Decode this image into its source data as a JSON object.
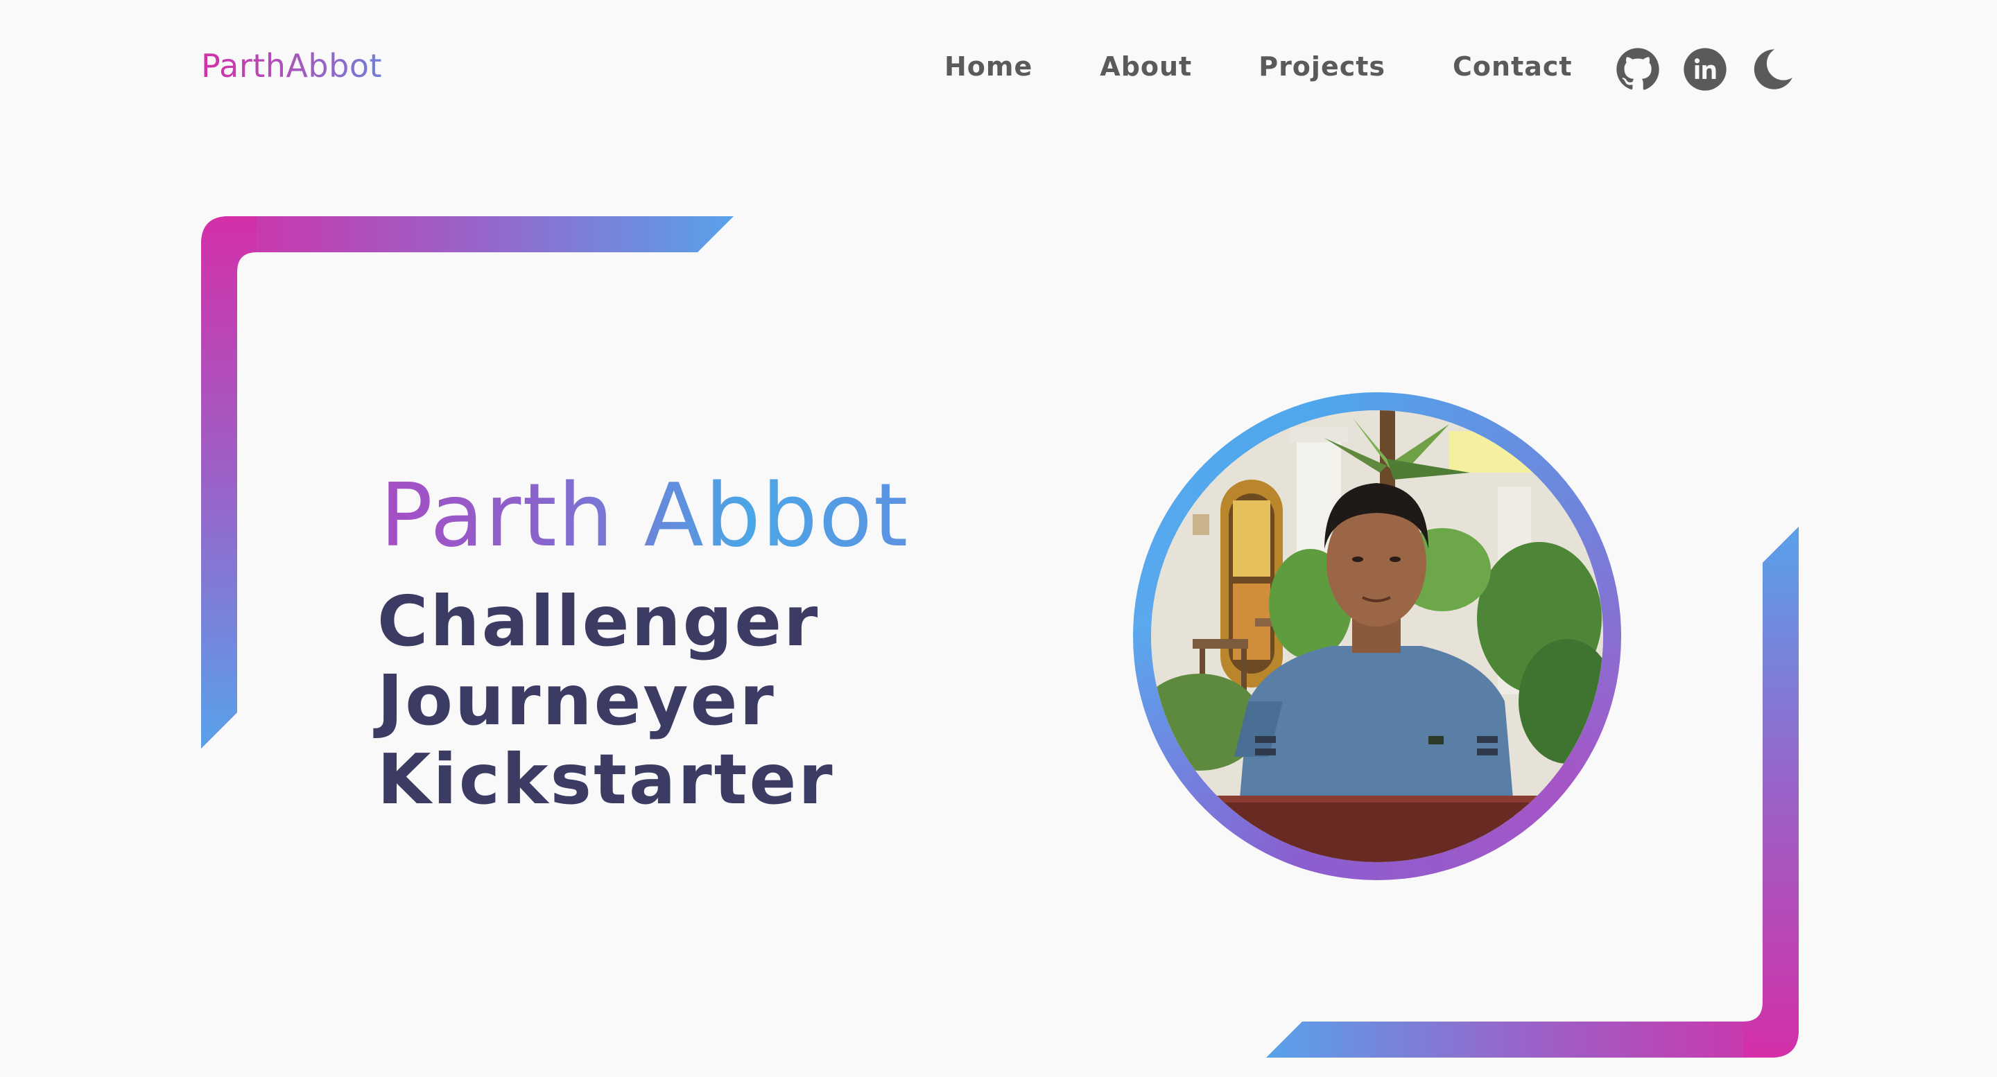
{
  "logo": {
    "text": "ParthAbbot"
  },
  "nav": {
    "items": [
      {
        "label": "Home"
      },
      {
        "label": "About"
      },
      {
        "label": "Projects"
      },
      {
        "label": "Contact"
      }
    ],
    "icons": [
      "github-icon",
      "linkedin-icon",
      "moon-icon"
    ]
  },
  "hero": {
    "name": "Parth Abbot",
    "traits": [
      "Challenger",
      "Journeyer",
      "Kickstarter"
    ]
  },
  "colors": {
    "background": "#f9f9f9",
    "gradient_pink": "#d42fa8",
    "gradient_purple": "#a655c6",
    "gradient_blue": "#4fa7ec",
    "text_dark": "#3b3b63",
    "nav_text": "#5a5a5a"
  }
}
